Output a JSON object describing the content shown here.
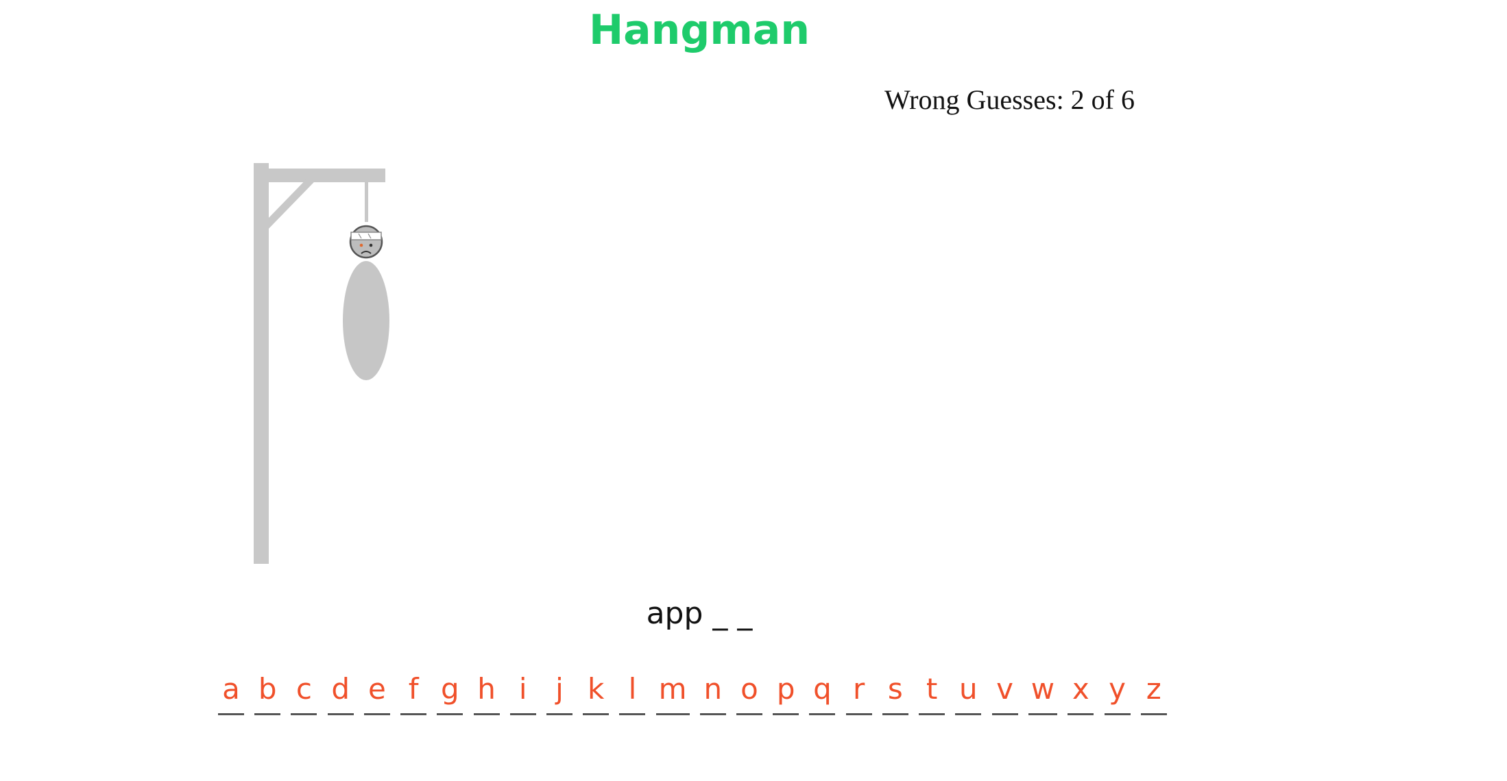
{
  "game": {
    "title": "Hangman",
    "wrong_guesses_text": "Wrong Guesses: 2 of 6",
    "wrong_guesses": 2,
    "max_wrong_guesses": 6,
    "word_display": "app _ _"
  },
  "keyboard": {
    "letters": [
      "a",
      "b",
      "c",
      "d",
      "e",
      "f",
      "g",
      "h",
      "i",
      "j",
      "k",
      "l",
      "m",
      "n",
      "o",
      "p",
      "q",
      "r",
      "s",
      "t",
      "u",
      "v",
      "w",
      "x",
      "y",
      "z"
    ]
  },
  "colors": {
    "title": "#1ecb6b",
    "letters": "#f0502a",
    "gallows": "#c8c8c8",
    "underline": "#555555",
    "text": "#111111"
  },
  "icons": {
    "figure_head": "bandaged-face-icon"
  }
}
